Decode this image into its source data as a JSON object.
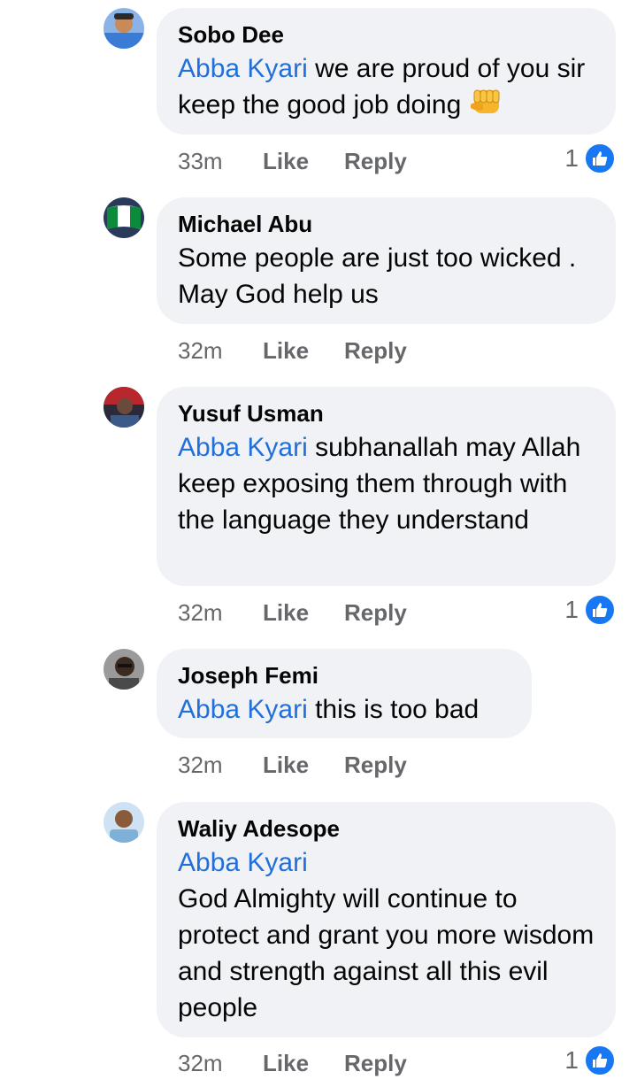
{
  "comments": [
    {
      "author": "Sobo Dee",
      "mention": "Abba Kyari",
      "text": " we are proud of you sir keep the good job doing ",
      "emoji": "raised-fist",
      "time": "33m",
      "like_label": "Like",
      "reply_label": "Reply",
      "reactions": "1",
      "avatar_colors": [
        "#3a7bd5",
        "#c98a5a"
      ]
    },
    {
      "author": "Michael Abu",
      "mention": "",
      "text": "Some people are just too wicked . May God help us",
      "time": "32m",
      "like_label": "Like",
      "reply_label": "Reply",
      "reactions": "",
      "avatar_colors": [
        "#0a8a3a",
        "#ffffff"
      ]
    },
    {
      "author": "Yusuf Usman",
      "mention": "Abba Kyari",
      "text": " subhanallah may Allah keep exposing them through with the language they understand",
      "time": "32m",
      "like_label": "Like",
      "reply_label": "Reply",
      "reactions": "1",
      "avatar_colors": [
        "#b8262e",
        "#2a2a3a"
      ]
    },
    {
      "author": "Joseph Femi",
      "mention": "Abba Kyari",
      "text": " this is too bad",
      "time": "32m",
      "like_label": "Like",
      "reply_label": "Reply",
      "reactions": "",
      "avatar_colors": [
        "#6a6a6a",
        "#3b2a20"
      ]
    },
    {
      "author": "Waliy Adesope",
      "mention": "Abba Kyari",
      "text": "God Almighty will continue to protect and grant you more wisdom and strength against all this evil people",
      "time": "32m",
      "like_label": "Like",
      "reply_label": "Reply",
      "reactions": "1",
      "avatar_colors": [
        "#7fb0d8",
        "#8a5a3a"
      ]
    }
  ],
  "colors": {
    "bubble": "#f0f2f5",
    "mention": "#216fdb",
    "meta": "#65676b",
    "like_badge": "#1877f2"
  }
}
